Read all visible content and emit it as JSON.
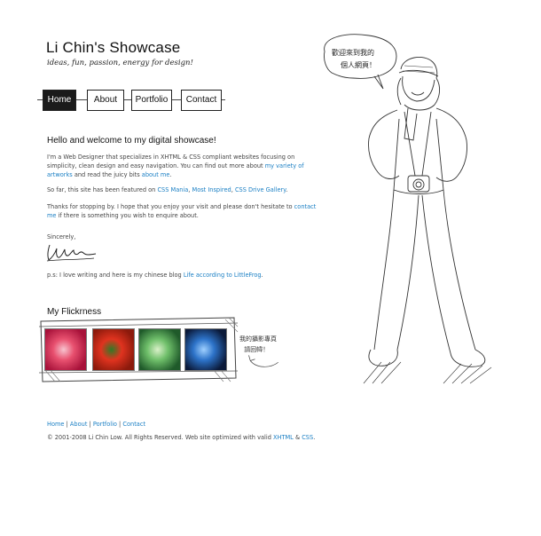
{
  "site": {
    "title": "Li Chin's Showcase",
    "tagline": "ideas, fun, passion, energy for design!"
  },
  "nav": {
    "items": [
      {
        "label": "Home",
        "active": true
      },
      {
        "label": "About",
        "active": false
      },
      {
        "label": "Portfolio",
        "active": false
      },
      {
        "label": "Contact",
        "active": false
      }
    ]
  },
  "main": {
    "heading": "Hello and welcome to my digital showcase!",
    "intro_a": "I'm a Web Designer that specializes in XHTML & CSS compliant websites focusing on simplicity, clean design and easy navigation. You can find out more about ",
    "intro_link1": "my variety of artworks",
    "intro_b": " and read the juicy bits ",
    "intro_link2": "about me",
    "intro_c": ".",
    "featured_a": "So far, this site has been featured on ",
    "featured_link1": "CSS Mania",
    "featured_sep1": ", ",
    "featured_link2": "Most Inspired",
    "featured_sep2": ", ",
    "featured_link3": "CSS Drive Gallery",
    "featured_end": ".",
    "thanks_a": "Thanks for stopping by. I hope that you enjoy your visit and please don't hesitate to ",
    "thanks_link": "contact me",
    "thanks_b": " if there is something you wish to enquire about.",
    "sincerely": "Sincerely,",
    "ps_a": "p.s: I love writing and here is my chinese blog ",
    "ps_link": "Life according to LittleFrog",
    "ps_end": "."
  },
  "flickr": {
    "title": "My Flickrness",
    "thumbs": [
      {
        "colors": [
          "#a8123a",
          "#e8506f",
          "#f7c4cf"
        ]
      },
      {
        "colors": [
          "#8c1a0c",
          "#e0331f",
          "#2f7a26"
        ]
      },
      {
        "colors": [
          "#1f5a2a",
          "#6fbf6a",
          "#d9f0c8"
        ]
      },
      {
        "colors": [
          "#0b1a3a",
          "#2d73c9",
          "#9fd0ff"
        ]
      }
    ],
    "note_line1": "我的攝影專頁",
    "note_line2": "請回幃！"
  },
  "bubble": {
    "line1": "歡迎來到我的",
    "line2": "個人網頁！"
  },
  "footer": {
    "links": [
      "Home",
      "About",
      "Portfolio",
      "Contact"
    ],
    "separator": " | ",
    "copyright_a": "© 2001-2008 Li Chin Low. All Rights Reserved. Web site optimized with valid ",
    "xhtml": "XHTML",
    "amp": " & ",
    "css": "CSS",
    "copyright_end": "."
  },
  "colors": {
    "link": "#1a7fc4",
    "text": "#444444",
    "heading": "#111111"
  }
}
